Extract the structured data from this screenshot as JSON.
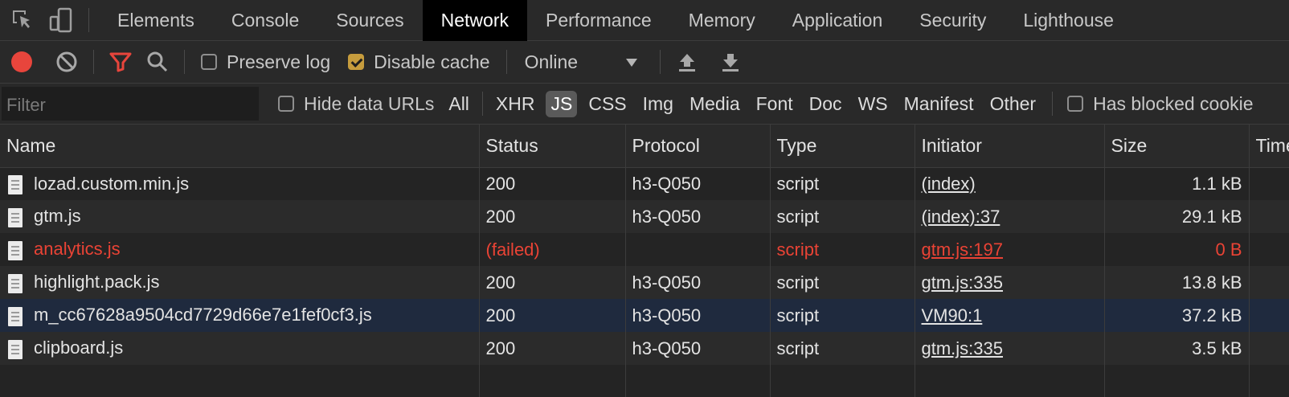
{
  "tabs": [
    {
      "label": "Elements",
      "active": false
    },
    {
      "label": "Console",
      "active": false
    },
    {
      "label": "Sources",
      "active": false
    },
    {
      "label": "Network",
      "active": true
    },
    {
      "label": "Performance",
      "active": false
    },
    {
      "label": "Memory",
      "active": false
    },
    {
      "label": "Application",
      "active": false
    },
    {
      "label": "Security",
      "active": false
    },
    {
      "label": "Lighthouse",
      "active": false
    }
  ],
  "toolbar": {
    "preserve_log": {
      "label": "Preserve log",
      "checked": false
    },
    "disable_cache": {
      "label": "Disable cache",
      "checked": true
    },
    "throttling": "Online"
  },
  "filterbar": {
    "filter_placeholder": "Filter",
    "hide_data_urls": "Hide data URLs",
    "types": [
      "All",
      "XHR",
      "JS",
      "CSS",
      "Img",
      "Media",
      "Font",
      "Doc",
      "WS",
      "Manifest",
      "Other"
    ],
    "active_type": "JS",
    "has_blocked_cookies": "Has blocked cookie"
  },
  "table": {
    "columns": [
      "Name",
      "Status",
      "Protocol",
      "Type",
      "Initiator",
      "Size",
      "Time"
    ],
    "rows": [
      {
        "name": "lozad.custom.min.js",
        "status": "200",
        "protocol": "h3-Q050",
        "type": "script",
        "initiator": "(index)",
        "size": "1.1 kB"
      },
      {
        "name": "gtm.js",
        "status": "200",
        "protocol": "h3-Q050",
        "type": "script",
        "initiator": "(index):37",
        "size": "29.1 kB"
      },
      {
        "name": "analytics.js",
        "status": "(failed)",
        "protocol": "",
        "type": "script",
        "initiator": "gtm.js:197",
        "size": "0 B",
        "failed": true
      },
      {
        "name": "highlight.pack.js",
        "status": "200",
        "protocol": "h3-Q050",
        "type": "script",
        "initiator": "gtm.js:335",
        "size": "13.8 kB"
      },
      {
        "name": "m_cc67628a9504cd7729d66e7e1fef0cf3.js",
        "status": "200",
        "protocol": "h3-Q050",
        "type": "script",
        "initiator": "VM90:1",
        "size": "37.2 kB",
        "selected": true
      },
      {
        "name": "clipboard.js",
        "status": "200",
        "protocol": "h3-Q050",
        "type": "script",
        "initiator": "gtm.js:335",
        "size": "3.5 kB"
      }
    ]
  },
  "colors": {
    "record": "#e8453c",
    "filter_icon": "#e8453c",
    "failed_text": "#ea4335",
    "checkbox_checked": "#c69c3d",
    "selected_row": "#1f2a3e"
  },
  "icons": [
    "inspect-element-icon",
    "device-toolbar-icon",
    "record-icon",
    "clear-icon",
    "filter-icon",
    "search-icon",
    "import-har-icon",
    "export-har-icon",
    "file-icon"
  ]
}
